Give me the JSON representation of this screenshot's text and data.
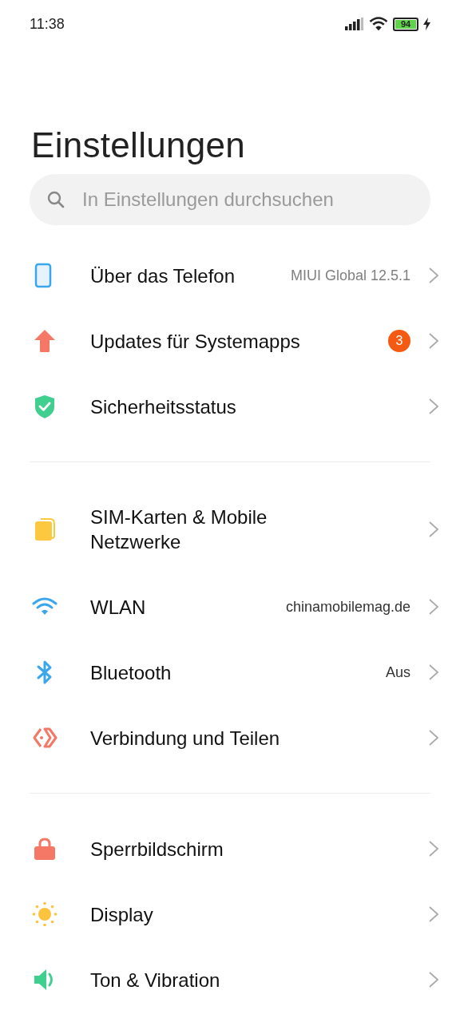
{
  "status_bar": {
    "time": "11:38",
    "battery": "94"
  },
  "title": "Einstellungen",
  "search": {
    "placeholder": "In Einstellungen durchsuchen"
  },
  "sections": [
    {
      "items": [
        {
          "label": "Über das Telefon",
          "value": "MIUI Global 12.5.1"
        },
        {
          "label": "Updates für Systemapps",
          "badge": "3"
        },
        {
          "label": "Sicherheitsstatus"
        }
      ]
    },
    {
      "items": [
        {
          "label": "SIM-Karten & Mobile Netzwerke"
        },
        {
          "label": "WLAN",
          "value": "chinamobilemag.de"
        },
        {
          "label": "Bluetooth",
          "value": "Aus"
        },
        {
          "label": "Verbindung und Teilen"
        }
      ]
    },
    {
      "items": [
        {
          "label": "Sperrbildschirm"
        },
        {
          "label": "Display"
        },
        {
          "label": "Ton & Vibration"
        }
      ]
    }
  ]
}
